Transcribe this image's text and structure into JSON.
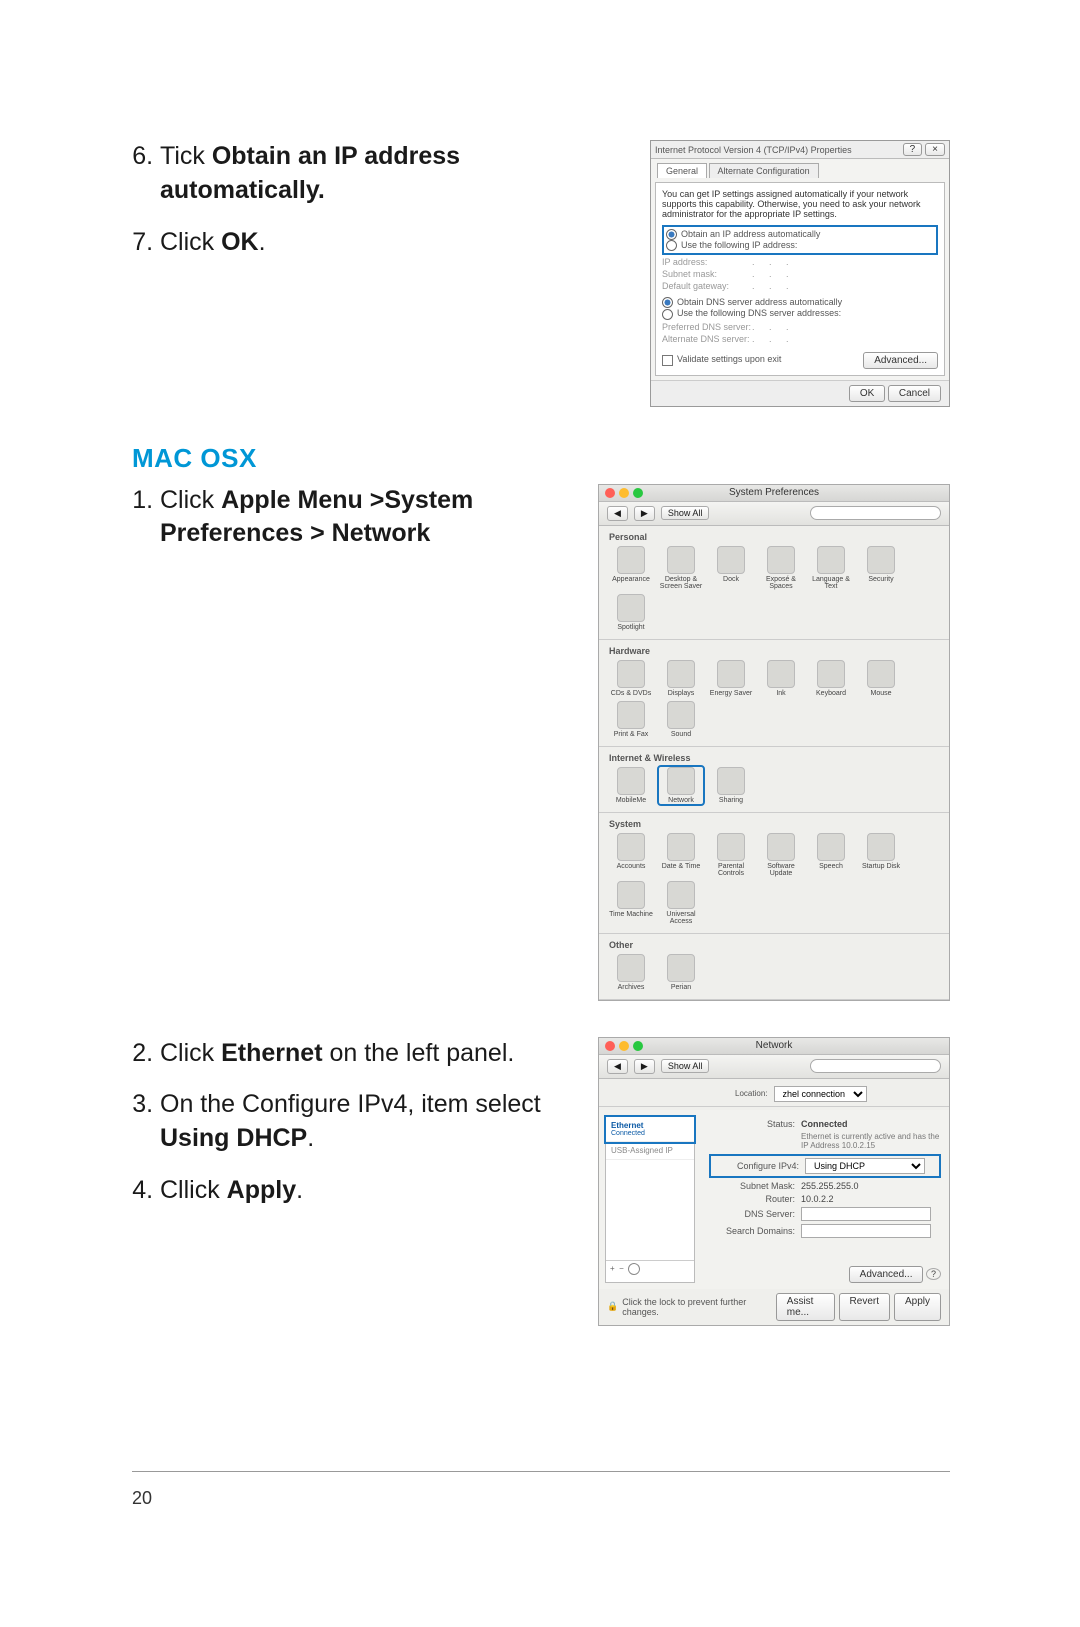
{
  "page_number": "20",
  "top_instructions": {
    "start": 6,
    "items": [
      {
        "pre": "Tick ",
        "bold": "Obtain an IP address automatically.",
        "post": ""
      },
      {
        "pre": "Click ",
        "bold": "OK",
        "post": "."
      }
    ]
  },
  "section_heading": "MAC OSX",
  "mac_step1": {
    "start": 1,
    "items": [
      {
        "pre": "Click ",
        "bold": "Apple Menu >System Preferences > Network",
        "post": ""
      }
    ]
  },
  "mac_steps_rest": {
    "start": 2,
    "items": [
      {
        "pre": "Click ",
        "bold": "Ethernet",
        "post": " on the left panel."
      },
      {
        "pre": "On the Configure IPv4, item select ",
        "bold": "Using DHCP",
        "post": "."
      },
      {
        "pre": "Cllick ",
        "bold": "Apply",
        "post": "."
      }
    ]
  },
  "win_dialog": {
    "title": "Internet Protocol Version 4 (TCP/IPv4) Properties",
    "tabs": [
      "General",
      "Alternate Configuration"
    ],
    "blurb": "You can get IP settings assigned automatically if your network supports this capability. Otherwise, you need to ask your network administrator for the appropriate IP settings.",
    "r1": "Obtain an IP address automatically",
    "r2": "Use the following IP address:",
    "f1": "IP address:",
    "f2": "Subnet mask:",
    "f3": "Default gateway:",
    "r3": "Obtain DNS server address automatically",
    "r4": "Use the following DNS server addresses:",
    "f4": "Preferred DNS server:",
    "f5": "Alternate DNS server:",
    "chk": "Validate settings upon exit",
    "adv": "Advanced...",
    "ok": "OK",
    "cancel": "Cancel"
  },
  "sysprefs": {
    "title": "System Preferences",
    "showall": "Show All",
    "search_ph": "",
    "sections": [
      {
        "hdr": "Personal",
        "items": [
          "Appearance",
          "Desktop & Screen Saver",
          "Dock",
          "Exposé & Spaces",
          "Language & Text",
          "Security",
          "Spotlight"
        ]
      },
      {
        "hdr": "Hardware",
        "items": [
          "CDs & DVDs",
          "Displays",
          "Energy Saver",
          "Ink",
          "Keyboard",
          "Mouse",
          "Print & Fax",
          "Sound"
        ]
      },
      {
        "hdr": "Internet & Wireless",
        "items": [
          "MobileMe",
          "Network",
          "Sharing"
        ],
        "highlight": 1
      },
      {
        "hdr": "System",
        "items": [
          "Accounts",
          "Date & Time",
          "Parental Controls",
          "Software Update",
          "Speech",
          "Startup Disk",
          "Time Machine",
          "Universal Access"
        ]
      },
      {
        "hdr": "Other",
        "items": [
          "Archives",
          "Perian"
        ]
      }
    ]
  },
  "network": {
    "title": "Network",
    "showall": "Show All",
    "loc_label": "Location:",
    "loc_value": "zhel connection",
    "side": [
      {
        "name": "Ethernet",
        "sub": "Connected",
        "hl": true
      },
      {
        "name": "USB-Assigned IP",
        "sub": ""
      }
    ],
    "status_label": "Status:",
    "status_value": "Connected",
    "status_sub": "Ethernet is currently active and has the IP Address 10.0.2.15",
    "cfg_label": "Configure IPv4:",
    "cfg_value": "Using DHCP",
    "subnet_label": "Subnet Mask:",
    "subnet_value": "255.255.255.0",
    "router_label": "Router:",
    "router_value": "10.0.2.2",
    "dns_label": "DNS Server:",
    "search_label": "Search Domains:",
    "adv": "Advanced...",
    "lock": "Click the lock to prevent further changes.",
    "assist": "Assist me...",
    "revert": "Revert",
    "apply": "Apply"
  }
}
